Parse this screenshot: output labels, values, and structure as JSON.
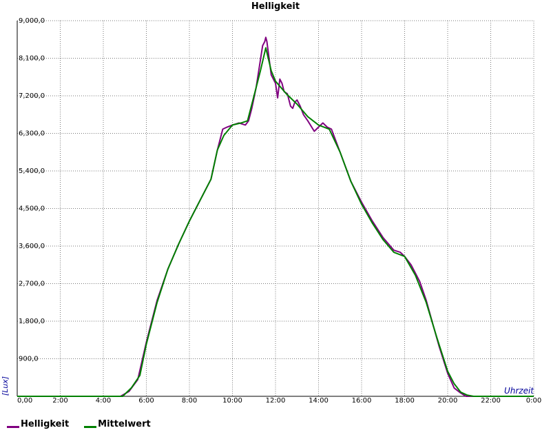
{
  "chart_data": {
    "type": "line",
    "title": "Helligkeit",
    "xlabel": "Uhrzeit",
    "ylabel": "[Lux]",
    "xlim": [
      0,
      24
    ],
    "ylim": [
      0,
      9000
    ],
    "x_ticks": [
      0,
      2,
      4,
      6,
      8,
      10,
      12,
      14,
      16,
      18,
      20,
      22,
      24
    ],
    "x_tick_labels": [
      "0,00",
      "2:00",
      "4:00",
      "6:00",
      "8:00",
      "10:00",
      "12:00",
      "14:00",
      "16:00",
      "18:00",
      "20:00",
      "22:00",
      "0:00"
    ],
    "y_ticks": [
      0,
      900,
      1800,
      2700,
      3600,
      4500,
      5400,
      6300,
      7200,
      8100,
      9000
    ],
    "y_tick_labels": [
      "",
      "900,0",
      "1,800,0",
      "2,700,0",
      "3,600,0",
      "4,500,0",
      "5,400,0",
      "6,300,0",
      "7,200,0",
      "8,100,0",
      "9,000,0"
    ],
    "grid": true,
    "legend_position": "bottom-left",
    "series": [
      {
        "name": "Helligkeit",
        "color": "#800080",
        "x": [
          0,
          4.8,
          5.2,
          5.6,
          6.0,
          6.5,
          7.0,
          7.5,
          8.0,
          8.5,
          9.0,
          9.3,
          9.55,
          9.75,
          10.0,
          10.3,
          10.6,
          10.75,
          10.9,
          11.1,
          11.25,
          11.4,
          11.5,
          11.55,
          11.6,
          11.8,
          12.0,
          12.1,
          12.2,
          12.3,
          12.4,
          12.55,
          12.7,
          12.8,
          12.9,
          13.0,
          13.15,
          13.3,
          13.5,
          13.8,
          14.0,
          14.2,
          14.4,
          14.6,
          15.0,
          15.5,
          16.0,
          16.5,
          17.0,
          17.5,
          17.8,
          18.0,
          18.3,
          18.7,
          19.0,
          19.3,
          19.6,
          20.0,
          20.3,
          20.6,
          20.85,
          21.1,
          21.5,
          24
        ],
        "y": [
          0,
          0,
          120,
          400,
          1300,
          2300,
          3050,
          3650,
          4200,
          4700,
          5200,
          5900,
          6400,
          6450,
          6500,
          6550,
          6500,
          6600,
          6900,
          7400,
          7900,
          8400,
          8500,
          8600,
          8500,
          7700,
          7500,
          7150,
          7600,
          7500,
          7300,
          7250,
          6950,
          6900,
          7050,
          7100,
          6950,
          6750,
          6600,
          6350,
          6450,
          6550,
          6450,
          6400,
          5850,
          5150,
          4650,
          4200,
          3800,
          3500,
          3450,
          3350,
          3150,
          2750,
          2300,
          1750,
          1200,
          550,
          200,
          80,
          0,
          0,
          0,
          0
        ]
      },
      {
        "name": "Mittelwert",
        "color": "#008000",
        "x": [
          0,
          4.9,
          5.3,
          5.7,
          6.0,
          6.5,
          7.0,
          7.5,
          8.0,
          8.5,
          9.0,
          9.3,
          9.6,
          10.0,
          10.4,
          10.7,
          11.0,
          11.3,
          11.55,
          11.8,
          12.0,
          12.5,
          13.0,
          13.5,
          14.0,
          14.5,
          15.0,
          15.5,
          16.0,
          16.5,
          17.0,
          17.5,
          18.0,
          18.5,
          19.0,
          19.5,
          20.0,
          20.3,
          20.6,
          20.9,
          21.2,
          21.5,
          24
        ],
        "y": [
          0,
          0,
          200,
          500,
          1250,
          2250,
          3050,
          3650,
          4200,
          4700,
          5200,
          5900,
          6250,
          6500,
          6550,
          6600,
          7200,
          7800,
          8350,
          7800,
          7550,
          7250,
          7000,
          6700,
          6500,
          6400,
          5850,
          5150,
          4600,
          4150,
          3750,
          3450,
          3350,
          2900,
          2250,
          1400,
          600,
          300,
          100,
          30,
          0,
          0,
          0
        ]
      }
    ]
  }
}
